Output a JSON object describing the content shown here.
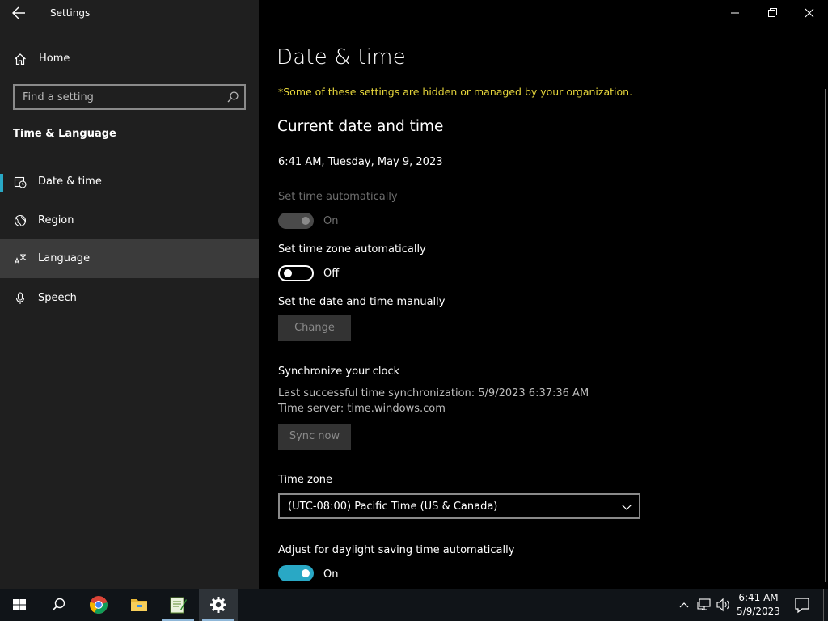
{
  "app": {
    "title": "Settings"
  },
  "sidebar": {
    "home_label": "Home",
    "search_placeholder": "Find a setting",
    "section_title": "Time & Language",
    "items": [
      {
        "label": "Date & time",
        "icon": "clock-calendar-icon",
        "selected": true
      },
      {
        "label": "Region",
        "icon": "globe-icon"
      },
      {
        "label": "Language",
        "icon": "language-icon",
        "hovered": true
      },
      {
        "label": "Speech",
        "icon": "microphone-icon"
      }
    ]
  },
  "main": {
    "page_title": "Date & time",
    "managed_note": "*Some of these settings are hidden or managed by your organization.",
    "section_heading": "Current date and time",
    "current_datetime": "6:41 AM, Tuesday, May 9, 2023",
    "set_time_auto": {
      "label": "Set time automatically",
      "state": "On",
      "enabled": false
    },
    "set_tz_auto": {
      "label": "Set time zone automatically",
      "state": "Off"
    },
    "manual": {
      "label": "Set the date and time manually",
      "button": "Change"
    },
    "sync": {
      "label": "Synchronize your clock",
      "last_sync": "Last successful time synchronization: 5/9/2023 6:37:36 AM",
      "server": "Time server: time.windows.com",
      "button": "Sync now"
    },
    "timezone": {
      "label": "Time zone",
      "value": "(UTC-08:00) Pacific Time (US & Canada)"
    },
    "dst": {
      "label": "Adjust for daylight saving time automatically",
      "state": "On"
    }
  },
  "taskbar": {
    "clock_time": "6:41 AM",
    "clock_date": "5/9/2023",
    "accent": "#29a8c5",
    "note_color": "#e5d53b"
  }
}
